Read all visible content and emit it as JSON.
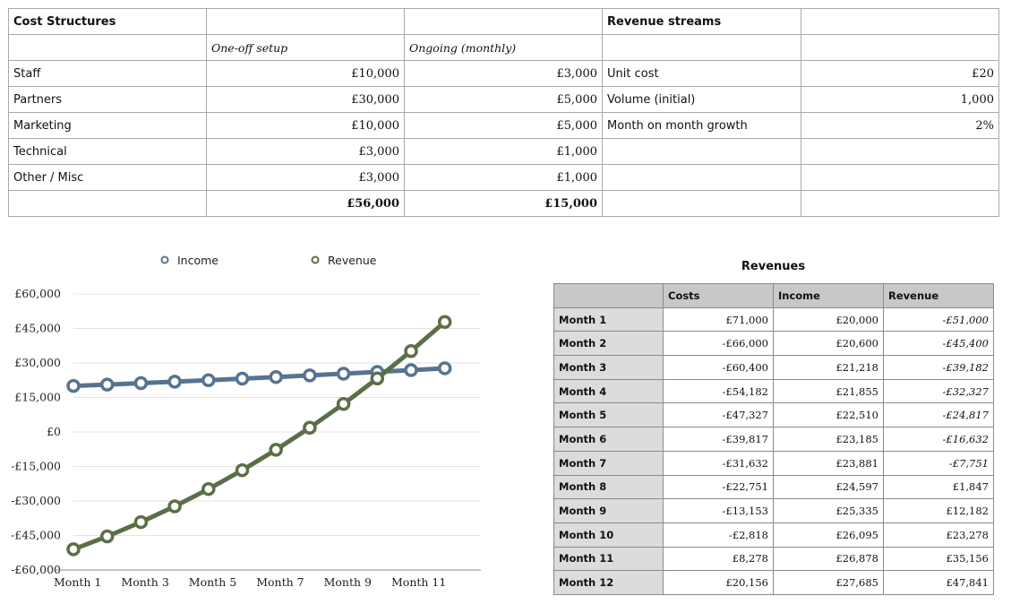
{
  "cost_table": {
    "header": [
      "Cost Structures",
      "",
      "",
      "Revenue streams",
      ""
    ],
    "subheader": [
      "",
      "One-off setup",
      "Ongoing (monthly)",
      "",
      ""
    ],
    "rows": [
      {
        "label": "Staff",
        "setup": "£10,000",
        "monthly": "£3,000",
        "rs_label": "Unit cost",
        "rs_value": "£20"
      },
      {
        "label": "Partners",
        "setup": "£30,000",
        "monthly": "£5,000",
        "rs_label": "Volume (initial)",
        "rs_value": "1,000"
      },
      {
        "label": "Marketing",
        "setup": "£10,000",
        "monthly": "£5,000",
        "rs_label": "Month on month growth",
        "rs_value": "2%"
      },
      {
        "label": "Technical",
        "setup": "£3,000",
        "monthly": "£1,000",
        "rs_label": "",
        "rs_value": ""
      },
      {
        "label": "Other / Misc",
        "setup": "£3,000",
        "monthly": "£1,000",
        "rs_label": "",
        "rs_value": ""
      }
    ],
    "totals": {
      "setup": "£56,000",
      "monthly": "£15,000"
    }
  },
  "revenues_table": {
    "title": "Revenues",
    "columns": [
      "",
      "Costs",
      "Income",
      "Revenue"
    ],
    "rows": [
      {
        "month": "Month 1",
        "costs": "£71,000",
        "income": "£20,000",
        "revenue": "-£51,000"
      },
      {
        "month": "Month 2",
        "costs": "-£66,000",
        "income": "£20,600",
        "revenue": "-£45,400"
      },
      {
        "month": "Month 3",
        "costs": "-£60,400",
        "income": "£21,218",
        "revenue": "-£39,182"
      },
      {
        "month": "Month 4",
        "costs": "-£54,182",
        "income": "£21,855",
        "revenue": "-£32,327"
      },
      {
        "month": "Month 5",
        "costs": "-£47,327",
        "income": "£22,510",
        "revenue": "-£24,817"
      },
      {
        "month": "Month 6",
        "costs": "-£39,817",
        "income": "£23,185",
        "revenue": "-£16,632"
      },
      {
        "month": "Month 7",
        "costs": "-£31,632",
        "income": "£23,881",
        "revenue": "-£7,751"
      },
      {
        "month": "Month 8",
        "costs": "-£22,751",
        "income": "£24,597",
        "revenue": "£1,847"
      },
      {
        "month": "Month 9",
        "costs": "-£13,153",
        "income": "£25,335",
        "revenue": "£12,182"
      },
      {
        "month": "Month 10",
        "costs": "-£2,818",
        "income": "£26,095",
        "revenue": "£23,278"
      },
      {
        "month": "Month 11",
        "costs": "£8,278",
        "income": "£26,878",
        "revenue": "£35,156"
      },
      {
        "month": "Month 12",
        "costs": "£20,156",
        "income": "£27,685",
        "revenue": "£47,841"
      }
    ]
  },
  "chart_data": {
    "type": "line",
    "x": [
      "Month 1",
      "Month 2",
      "Month 3",
      "Month 4",
      "Month 5",
      "Month 6",
      "Month 7",
      "Month 8",
      "Month 9",
      "Month 10",
      "Month 11",
      "Month 12"
    ],
    "x_tick_labels": [
      "Month 1",
      "Month 3",
      "Month 5",
      "Month 7",
      "Month 9",
      "Month 11"
    ],
    "series": [
      {
        "name": "Income",
        "color": "#56748f",
        "values": [
          20000,
          20600,
          21218,
          21855,
          22510,
          23185,
          23881,
          24597,
          25335,
          26095,
          26878,
          27685
        ]
      },
      {
        "name": "Revenue",
        "color": "#5b6f47",
        "values": [
          -51000,
          -45400,
          -39182,
          -32327,
          -24817,
          -16632,
          -7751,
          1847,
          12182,
          23278,
          35156,
          47841
        ]
      }
    ],
    "y_tick_labels": [
      "£60,000",
      "£45,000",
      "£30,000",
      "£15,000",
      "£0",
      "-£15,000",
      "-£30,000",
      "-£45,000",
      "-£60,000"
    ],
    "ylim": [
      -60000,
      60000
    ],
    "grid": true,
    "legend_position": "top"
  }
}
